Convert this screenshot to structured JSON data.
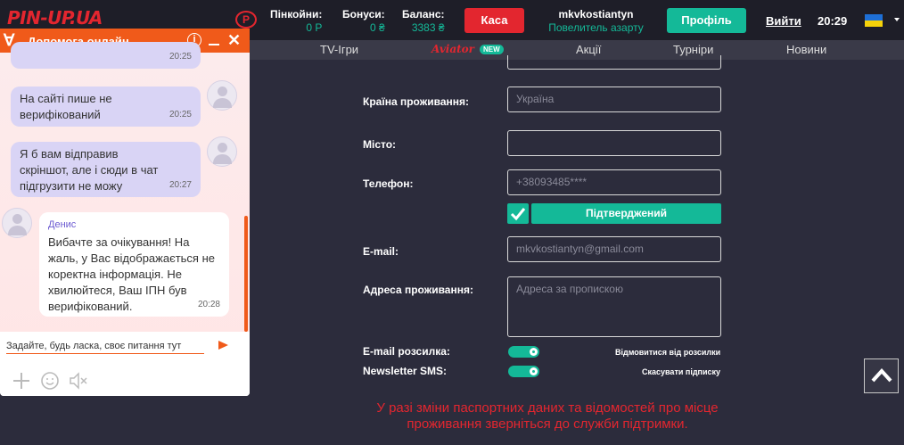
{
  "header": {
    "logo": "PIN-UP.UA",
    "pins_label": "Пінкойни:",
    "pins_value": "0 P",
    "bonus_label": "Бонуси:",
    "bonus_value": "0 ₴",
    "balance_label": "Баланс:",
    "balance_value": "3383 ₴",
    "cashier_button": "Каса",
    "username": "mkvkostiantyn",
    "rank": "Повелитель азарту",
    "profile_button": "Профіль",
    "logout": "Вийти",
    "time": "20:29",
    "language_flag": "ukraine-flag"
  },
  "nav": {
    "items": [
      "TV-Ігри",
      "Aviator",
      "Акції",
      "Турніри",
      "Новини"
    ],
    "aviator_badge": "NEW"
  },
  "form": {
    "country_label": "Країна проживання:",
    "country_value": "Україна",
    "city_label": "Місто:",
    "city_value": "",
    "phone_label": "Телефон:",
    "phone_value": "+38093485****",
    "phone_status": "Підтверджений",
    "email_label": "E-mail:",
    "email_value": "mkvkostiantyn@gmail.com",
    "address_label": "Адреса проживання:",
    "address_placeholder": "Адреса за пропискою",
    "email_newsletter_label": "E-mail розсилка:",
    "email_unsubscribe": "Відмовитися від розсилки",
    "sms_newsletter_label": "Newsletter SMS:",
    "sms_unsubscribe": "Скасувати підписку",
    "email_newsletter_on": true,
    "sms_newsletter_on": true,
    "warning": "У разі зміни паспортних даних та відомостей про місце проживання зверніться до служби підтримки."
  },
  "chat": {
    "title": "Допомога онлайн",
    "messages": [
      {
        "from": "user",
        "time": "20:25",
        "text": ""
      },
      {
        "from": "user",
        "time": "20:25",
        "text": "На сайті пише не верифікований"
      },
      {
        "from": "user",
        "time": "20:27",
        "text": "Я б вам відправив скріншот, але і сюди в чат підгрузити не можу"
      },
      {
        "from": "agent",
        "sender": "Денис",
        "time": "20:28",
        "text": "Вибачте за очікування! На жаль, у Вас відображається не коректна інформація. Не хвилюйтеся, Ваш ІПН був верифікований."
      }
    ],
    "input_placeholder": "Задайте, будь ласка, своє питання тут",
    "colors": {
      "accent": "#f05a1a",
      "user_bubble": "#d9d4f5"
    }
  },
  "colors": {
    "brand_red": "#e3262f",
    "teal": "#14b998",
    "bg": "#2c2c3c"
  }
}
